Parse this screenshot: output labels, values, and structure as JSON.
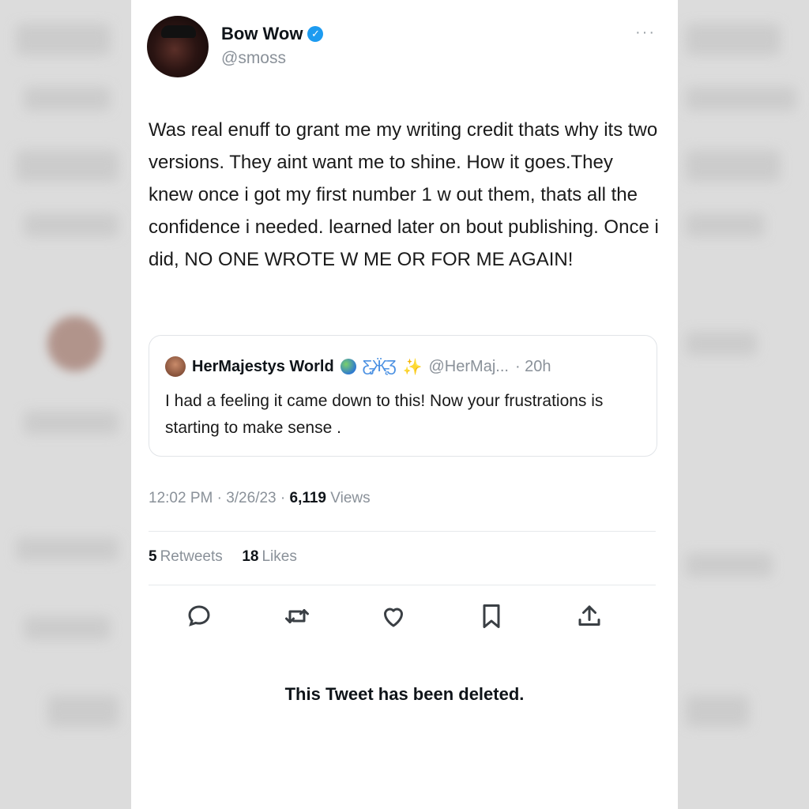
{
  "author": {
    "name": "Bow Wow",
    "handle": "@smoss",
    "verified_icon": "verified-badge-icon",
    "avatar_icon": "profile-photo"
  },
  "more_icon": "more-horizontal-icon",
  "tweet": {
    "text": "Was real enuff to grant me my writing credit thats why its two versions. They aint want me to shine. How it goes.They knew once i got my first number 1 w out them, thats all the confidence i needed. learned later on bout publishing. Once i did, NO ONE WROTE W ME OR FOR ME AGAIN!"
  },
  "quote": {
    "name": "HerMajestys World",
    "emojis": [
      "globe-emoji",
      "butterfly-emoji",
      "sparkles-emoji"
    ],
    "handle": "@HerMaj...",
    "age": "· 20h",
    "text": "I had a feeling it came down to this! Now your frustrations is starting to make sense ."
  },
  "meta": {
    "time": "12:02 PM · 3/26/23 · ",
    "views_count": "6,119",
    "views_label": "Views"
  },
  "stats": {
    "retweets_count": "5",
    "retweets_label": "Retweets",
    "likes_count": "18",
    "likes_label": "Likes"
  },
  "actions": [
    "reply-icon",
    "retweet-icon",
    "like-icon",
    "bookmark-icon",
    "share-icon"
  ],
  "deleted_notice": "This Tweet has been deleted.",
  "colors": {
    "accent": "#1d9bf0",
    "text": "#0f1419",
    "secondary": "#8a9199"
  }
}
